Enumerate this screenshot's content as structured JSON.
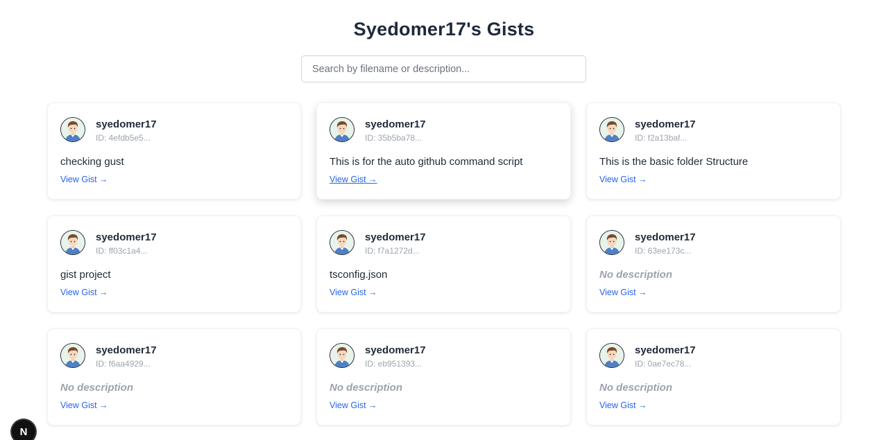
{
  "page": {
    "title": "Syedomer17's Gists"
  },
  "search": {
    "placeholder": "Search by filename or description...",
    "value": ""
  },
  "gists": [
    {
      "username": "syedomer17",
      "id": "ID: 4efdb5e5...",
      "description": "checking gust",
      "empty": false,
      "link": "View Gist →",
      "hover": false
    },
    {
      "username": "syedomer17",
      "id": "ID: 35b5ba78...",
      "description": "This is for the auto github command script",
      "empty": false,
      "link": "View Gist →",
      "hover": true
    },
    {
      "username": "syedomer17",
      "id": "ID: f2a13baf...",
      "description": "This is the basic folder Structure",
      "empty": false,
      "link": "View Gist →",
      "hover": false
    },
    {
      "username": "syedomer17",
      "id": "ID: ff03c1a4...",
      "description": "gist project",
      "empty": false,
      "link": "View Gist →",
      "hover": false
    },
    {
      "username": "syedomer17",
      "id": "ID: f7a1272d...",
      "description": "tsconfig.json",
      "empty": false,
      "link": "View Gist →",
      "hover": false
    },
    {
      "username": "syedomer17",
      "id": "ID: 63ee173c...",
      "description": "No description",
      "empty": true,
      "link": "View Gist →",
      "hover": false
    },
    {
      "username": "syedomer17",
      "id": "ID: f6aa4929...",
      "description": "No description",
      "empty": true,
      "link": "View Gist →",
      "hover": false
    },
    {
      "username": "syedomer17",
      "id": "ID: eb951393...",
      "description": "No description",
      "empty": true,
      "link": "View Gist →",
      "hover": false
    },
    {
      "username": "syedomer17",
      "id": "ID: 0ae7ec78...",
      "description": "No description",
      "empty": true,
      "link": "View Gist →",
      "hover": false
    }
  ],
  "dev_badge": {
    "label": "N",
    "icon": "nextjs-icon"
  },
  "colors": {
    "link": "#2563eb",
    "title": "#1e293b",
    "muted": "#9ca3af"
  }
}
